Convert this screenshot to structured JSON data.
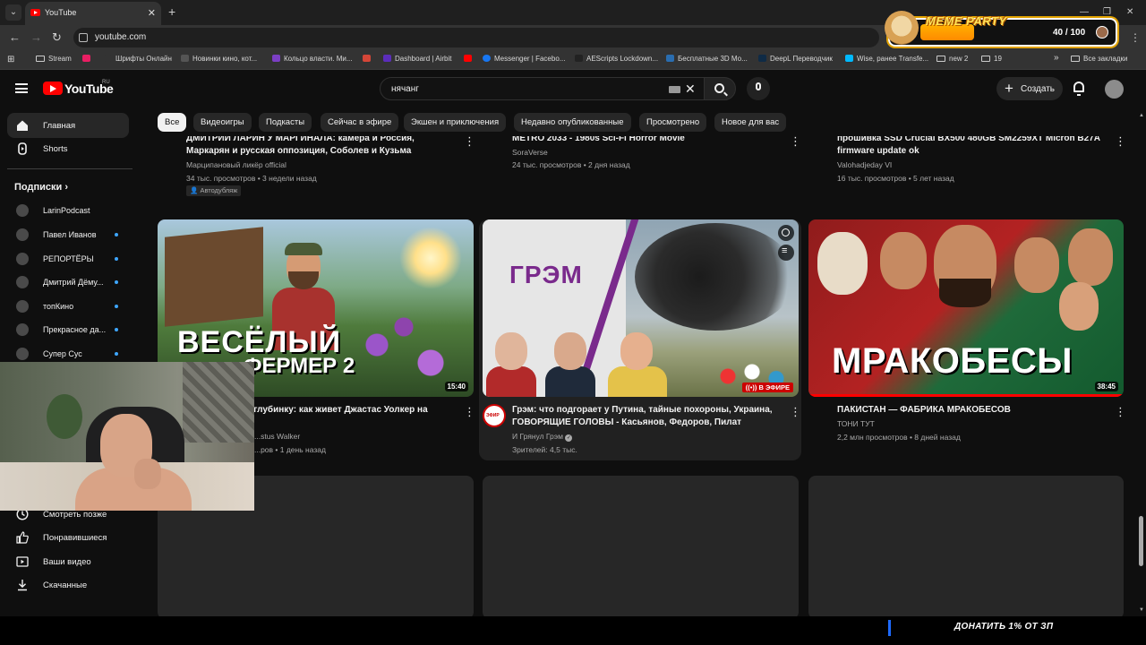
{
  "browser": {
    "tab_title": "YouTube",
    "url": "youtube.com",
    "bookmarks": [
      {
        "label": "Stream",
        "type": "folder"
      },
      {
        "label": "",
        "type": "icon",
        "color": "#e91e63"
      },
      {
        "label": "Шрифты Онлайн",
        "type": "icon",
        "color": "#333333"
      },
      {
        "label": "Новинки кино, кот...",
        "type": "icon",
        "color": "#444444"
      },
      {
        "label": "Кольцо власти. Ми...",
        "type": "icon",
        "color": "#7b3fc4"
      },
      {
        "label": "",
        "type": "icon",
        "color": "#d44638"
      },
      {
        "label": "Dashboard | Airbit",
        "type": "icon",
        "color": "#5b2dbb"
      },
      {
        "label": "",
        "type": "icon",
        "color": "#ff0000"
      },
      {
        "label": "Messenger | Facebo...",
        "type": "icon",
        "color": "#1877f2"
      },
      {
        "label": "AEScripts Lockdown...",
        "type": "icon",
        "color": "#222222"
      },
      {
        "label": "Бесплатные 3D Мо...",
        "type": "icon",
        "color": "#2a6db0"
      },
      {
        "label": "DeepL Переводчик",
        "type": "icon",
        "color": "#0f2b46"
      },
      {
        "label": "Wise, ранее Transfe...",
        "type": "icon",
        "color": "#00b9ff"
      },
      {
        "label": "new 2",
        "type": "folder"
      },
      {
        "label": "19",
        "type": "folder"
      }
    ],
    "bookmarks_more": "»",
    "all_bookmarks": "Все закладки"
  },
  "youtube": {
    "wordmark": "YouTube",
    "region": "RU",
    "search_query": "нячанг",
    "create_label": "Создать",
    "sidebar": {
      "main": [
        {
          "label": "Главная",
          "icon": "home-icon",
          "active": true
        },
        {
          "label": "Shorts",
          "icon": "shorts-icon",
          "active": false
        }
      ],
      "subscriptions_title": "Подписки",
      "subscriptions": [
        {
          "label": "LarinPodcast",
          "live": false
        },
        {
          "label": "Павел Иванов",
          "live": true
        },
        {
          "label": "РЕПОРТЁРЫ",
          "live": true
        },
        {
          "label": "Дмитрий Дёму...",
          "live": true
        },
        {
          "label": "топКино",
          "live": true
        },
        {
          "label": "Прекрасное да...",
          "live": true
        },
        {
          "label": "Супер Сус",
          "live": true
        }
      ],
      "you": [
        {
          "label": "Смотреть позже",
          "icon": "watch-later-icon"
        },
        {
          "label": "Понравившиеся",
          "icon": "like-icon"
        },
        {
          "label": "Ваши видео",
          "icon": "your-videos-icon"
        },
        {
          "label": "Скачанные",
          "icon": "download-icon"
        }
      ]
    },
    "chips": [
      "Все",
      "Видеоигры",
      "Подкасты",
      "Сейчас в эфире",
      "Экшен и приключения",
      "Недавно опубликованные",
      "Просмотрено",
      "Новое для вас"
    ],
    "row1": [
      {
        "title_line1": "ДМИТРИЙ ЛАРИН У МАРГИНАЛА: камера и Россия,",
        "title_line2": "Маркарян и русская оппозиция, Соболев и Кузьма",
        "channel": "Марципановый ликёр official",
        "stats": "34 тыс. просмотров • 3 недели назад",
        "badge": "Автодубляж"
      },
      {
        "title_line1": "METRO 2033 - 1980s Sci-Fi Horror Movie",
        "title_line2": "",
        "channel": "SoraVerse",
        "stats": "24 тыс. просмотров • 2 дня назад",
        "badge": ""
      },
      {
        "title_line1": "прошивка SSD Crucial BX500 480GB SM2259XT Micron B27A",
        "title_line2": "firmware update ok",
        "channel": "Valohadjeday VI",
        "stats": "16 тыс. просмотров • 5 лет назад",
        "badge": ""
      }
    ],
    "row2": [
      {
        "thumb_text_1": "ВЕСЁЛЫЙ",
        "thumb_text_2": "ФЕРМЕР 2",
        "duration": "15:40",
        "title": "...ую глубинку: как живет Джастас Уолкер на",
        "channel": "...stus Walker",
        "stats": "...ров • 1 день назад"
      },
      {
        "thumb_logo": "ГРЭМ",
        "live_badge": "В ЭФИРЕ",
        "avatar_label": "ЭФИР",
        "title_line1": "Грэм: что подгорает у Путина, тайные похороны, Украина,",
        "title_line2": "ГОВОРЯЩИЕ ГОЛОВЫ - Касьянов, Федоров, Пилат",
        "channel": "И Грянул Грэм",
        "viewers": "Зрителей: 4,5 тыс."
      },
      {
        "thumb_text": "МРАКОБЕСЫ",
        "duration": "38:45",
        "title": "ПАКИСТАН — ФАБРИКА МРАКОБЕСОВ",
        "channel": "ТОНИ ТУТ",
        "stats": "2,2 млн просмотров • 8 дней назад"
      }
    ]
  },
  "overlay": {
    "meme_title": "MEME PARTY",
    "meme_count": "40 / 100",
    "meme_progress_percent": 40,
    "donate": "ДОНАТИТЬ 1% ОТ ЗП"
  },
  "colors": {
    "bg": "#0f0f0f",
    "chip": "#272727",
    "accent_red": "#ff0000",
    "live_dot": "#3ea6ff"
  }
}
